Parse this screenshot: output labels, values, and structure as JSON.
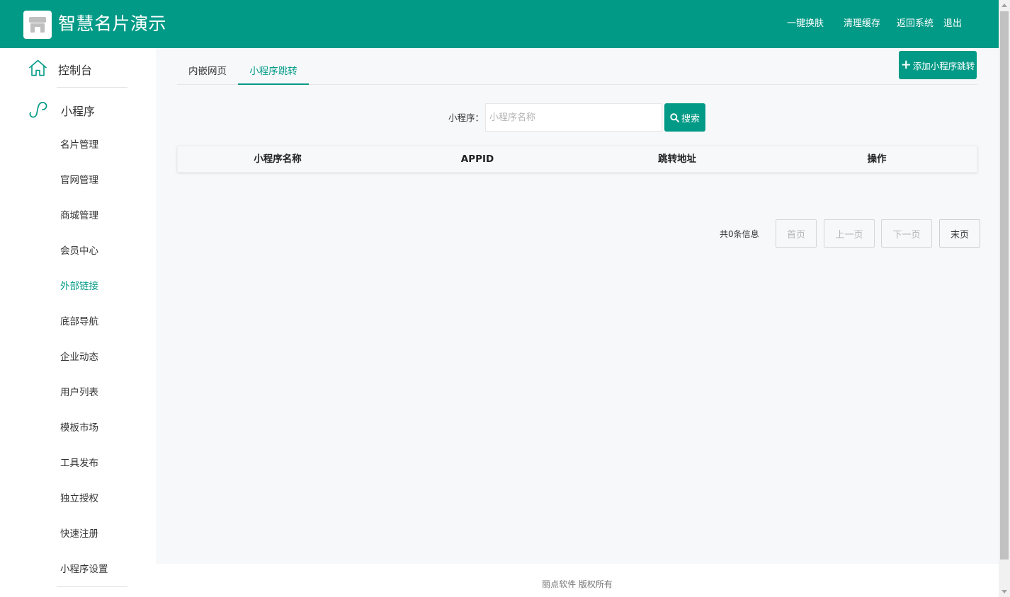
{
  "app": {
    "title": "智慧名片演示",
    "logo_icon": "store-icon"
  },
  "colors": {
    "primary": "#009a86",
    "page_bg": "#f7f8fa"
  },
  "top_nav": {
    "items": [
      "一键换肤",
      "清理缓存",
      "返回系统",
      "退出"
    ]
  },
  "sidebar": {
    "console": {
      "label": "控制台",
      "icon": "home-icon"
    },
    "miniapp": {
      "label": "小程序",
      "icon": "miniprogram-icon"
    },
    "items": [
      {
        "label": "名片管理"
      },
      {
        "label": "官网管理"
      },
      {
        "label": "商城管理"
      },
      {
        "label": "会员中心"
      },
      {
        "label": "外部链接",
        "active": true
      },
      {
        "label": "底部导航"
      },
      {
        "label": "企业动态"
      },
      {
        "label": "用户列表"
      },
      {
        "label": "模板市场"
      },
      {
        "label": "工具发布"
      },
      {
        "label": "独立授权"
      },
      {
        "label": "快速注册"
      },
      {
        "label": "小程序设置"
      }
    ]
  },
  "main": {
    "tabs": [
      {
        "label": "内嵌网页",
        "active": false
      },
      {
        "label": "小程序跳转",
        "active": true
      }
    ],
    "add_button": {
      "label": "添加小程序跳转",
      "icon": "plus-icon"
    },
    "search": {
      "label": "小程序：",
      "placeholder": "小程序名称",
      "value": "",
      "button_label": "搜索",
      "button_icon": "search-icon"
    },
    "table": {
      "columns": [
        "小程序名称",
        "APPID",
        "跳转地址",
        "操作"
      ],
      "rows": []
    },
    "pager": {
      "count_text": "共0条信息",
      "first": "首页",
      "prev": "上一页",
      "next": "下一页",
      "last": "末页"
    }
  },
  "footer": {
    "text": "丽点软件 版权所有"
  }
}
